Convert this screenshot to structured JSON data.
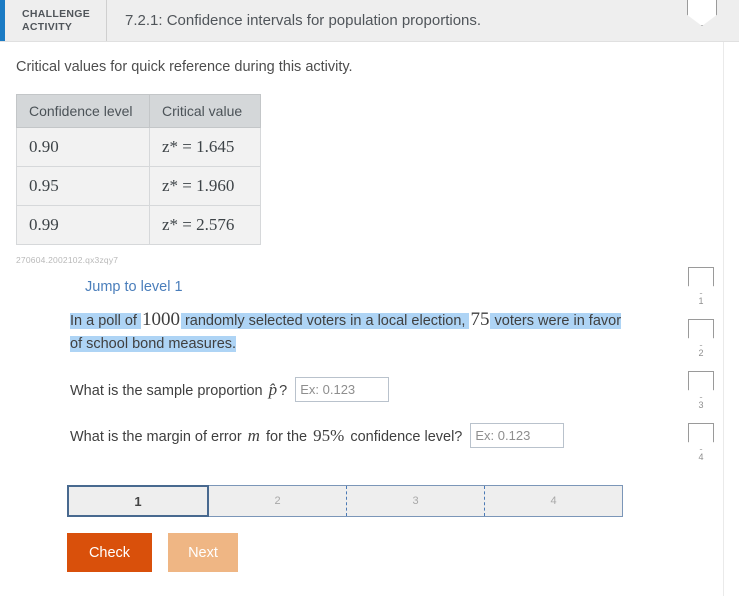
{
  "header": {
    "badge_line1": "CHALLENGE",
    "badge_line2": "ACTIVITY",
    "title": "7.2.1: Confidence intervals for population proportions.",
    "shield_icon": "bookmark-shield-icon",
    "accent_color": "#1b7bc4",
    "background_color": "#eeeeee"
  },
  "main": {
    "intro_text": "Critical values for quick reference during this activity.",
    "table": {
      "columns": [
        "Confidence level",
        "Critical value"
      ],
      "rows": [
        {
          "level": "0.90",
          "critical_value": "z* = 1.645"
        },
        {
          "level": "0.95",
          "critical_value": "z* = 1.960"
        },
        {
          "level": "0.99",
          "critical_value": "z* = 2.576"
        }
      ]
    },
    "reference_id": "270604.2002102.qx3zqy7",
    "jump_link": "Jump to level 1",
    "problem": {
      "part1": "In a poll of ",
      "sample_size": "1000",
      "part2": " randomly selected voters in a local election, ",
      "successes": "75",
      "part3": " voters were in favor of school bond measures.",
      "highlight_color": "#aed4f5"
    },
    "questions": [
      {
        "text_before": "What is the sample proportion ",
        "symbol": "p̂",
        "text_after": "?",
        "input_value": "",
        "input_placeholder": "Ex: 0.123"
      },
      {
        "text_before": "What is the margin of error ",
        "symbol": "m",
        "text_mid": " for the ",
        "confidence": "95%",
        "text_after": " confidence level?",
        "input_value": "",
        "input_placeholder": "Ex: 0.123"
      }
    ],
    "progress": {
      "steps": [
        "1",
        "2",
        "3",
        "4"
      ],
      "active_step": "1",
      "active_border_color": "#48698f"
    },
    "buttons": {
      "check_label": "Check",
      "check_color": "#d9500b",
      "next_label": "Next",
      "next_color": "#efb684"
    }
  },
  "right_rail": {
    "items": [
      {
        "icon": "bookmark-shield-icon",
        "number": "1"
      },
      {
        "icon": "bookmark-shield-icon",
        "number": "2"
      },
      {
        "icon": "bookmark-shield-icon",
        "number": "3"
      },
      {
        "icon": "bookmark-shield-icon",
        "number": "4"
      }
    ]
  }
}
